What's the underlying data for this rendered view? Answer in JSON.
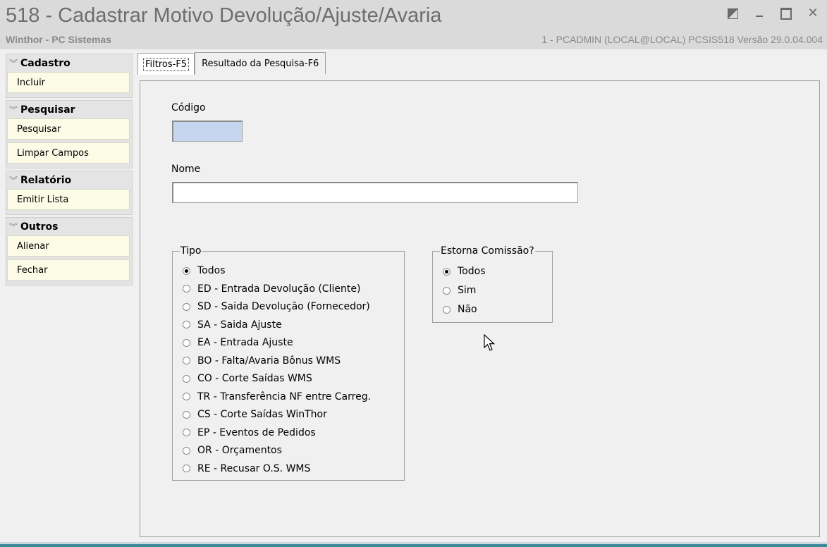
{
  "window": {
    "title": "518 - Cadastrar Motivo Devolução/Ajuste/Avaria",
    "subtitle": "Winthor - PC Sistemas",
    "user_info": "1 - PCADMIN (LOCAL@LOCAL)   PCSIS518  Versão  29.0.04.004",
    "controls": {
      "minimize": "_",
      "close": "✕"
    }
  },
  "sidebar": {
    "groups": [
      {
        "title": "Cadastro",
        "items": [
          "Incluir"
        ]
      },
      {
        "title": "Pesquisar",
        "items": [
          "Pesquisar",
          "Limpar Campos"
        ]
      },
      {
        "title": "Relatório",
        "items": [
          "Emitir Lista"
        ]
      },
      {
        "title": "Outros",
        "items": [
          "Alienar",
          "Fechar"
        ]
      }
    ]
  },
  "tabs": [
    {
      "label": "Filtros-F5",
      "active": true
    },
    {
      "label": "Resultado da Pesquisa-F6",
      "active": false
    }
  ],
  "form": {
    "codigo": {
      "label": "Código",
      "value": ""
    },
    "nome": {
      "label": "Nome",
      "value": ""
    },
    "tipo": {
      "label": "Tipo",
      "selected": 0,
      "options": [
        "Todos",
        "ED - Entrada Devolução (Cliente)",
        "SD - Saida Devolução (Fornecedor)",
        "SA - Saida Ajuste",
        "EA - Entrada Ajuste",
        "BO - Falta/Avaria Bônus WMS",
        "CO - Corte Saídas WMS",
        "TR - Transferência NF entre Carreg.",
        "CS - Corte Saídas WinThor",
        "EP - Eventos de Pedidos",
        "OR - Orçamentos",
        "RE - Recusar O.S. WMS"
      ]
    },
    "estorna": {
      "label": "Estorna Comissão?",
      "selected": 0,
      "options": [
        "Todos",
        "Sim",
        "Não"
      ]
    }
  },
  "colors": {
    "code_field_bg": "#c6d6ee",
    "sidebar_button_bg": "#fbfbe6",
    "title_text": "#6e6e6e"
  }
}
